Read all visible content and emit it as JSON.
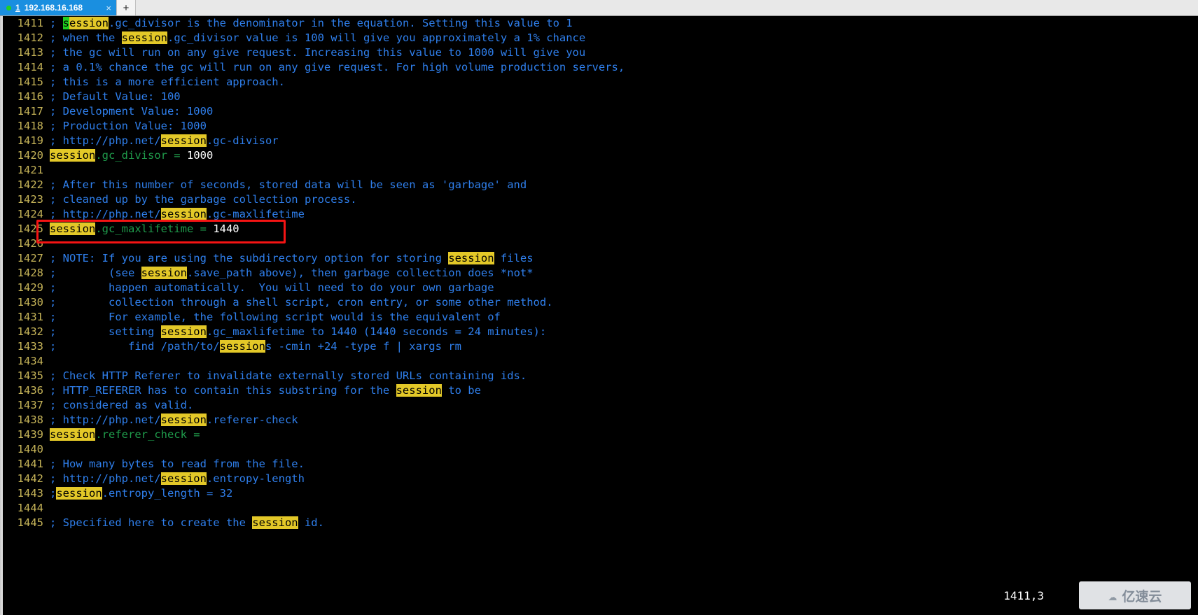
{
  "window": {
    "tab": {
      "index": "1",
      "title": "192.168.16.168",
      "close_label": "×",
      "status_dot": "connected",
      "new_tab_label": "+"
    },
    "accent_color": "#1a8fe0"
  },
  "editor": {
    "cursor_position": "1411,3",
    "highlight_term": "session",
    "colors": {
      "background": "#000000",
      "linenumber": "#c5b358",
      "comment": "#2f7fec",
      "directive": "#1f9b4b",
      "value": "#ffffff",
      "search_highlight_bg": "#e3c828",
      "cursor_bg": "#1fcf1f",
      "annotation": "#f41414"
    },
    "annotation": {
      "shape": "rectangle",
      "target_line": "1425",
      "target_text": "session.gc_maxlifetime = 1440"
    },
    "lines": [
      {
        "n": "1411",
        "segs": [
          {
            "t": "; ",
            "c": "cm"
          },
          {
            "t": "s",
            "c": "cur"
          },
          {
            "t": "ession",
            "c": "hl"
          },
          {
            "t": ".gc_divisor is the denominator in the equation. Setting this value to 1",
            "c": "cm"
          }
        ]
      },
      {
        "n": "1412",
        "segs": [
          {
            "t": "; when the ",
            "c": "cm"
          },
          {
            "t": "session",
            "c": "hl"
          },
          {
            "t": ".gc_divisor value is 100 will give you approximately a 1% chance",
            "c": "cm"
          }
        ]
      },
      {
        "n": "1413",
        "segs": [
          {
            "t": "; the gc will run on any give request. Increasing this value to 1000 will give you",
            "c": "cm"
          }
        ]
      },
      {
        "n": "1414",
        "segs": [
          {
            "t": "; a 0.1% chance the gc will run on any give request. For high volume production servers,",
            "c": "cm"
          }
        ]
      },
      {
        "n": "1415",
        "segs": [
          {
            "t": "; this is a more efficient approach.",
            "c": "cm"
          }
        ]
      },
      {
        "n": "1416",
        "segs": [
          {
            "t": "; Default Value: 100",
            "c": "cm"
          }
        ]
      },
      {
        "n": "1417",
        "segs": [
          {
            "t": "; Development Value: 1000",
            "c": "cm"
          }
        ]
      },
      {
        "n": "1418",
        "segs": [
          {
            "t": "; Production Value: 1000",
            "c": "cm"
          }
        ]
      },
      {
        "n": "1419",
        "segs": [
          {
            "t": "; http://php.net/",
            "c": "cm"
          },
          {
            "t": "session",
            "c": "hl"
          },
          {
            "t": ".gc-divisor",
            "c": "cm"
          }
        ]
      },
      {
        "n": "1420",
        "segs": [
          {
            "t": "session",
            "c": "hl"
          },
          {
            "t": ".gc_divisor = ",
            "c": "dr"
          },
          {
            "t": "1000",
            "c": "vl"
          }
        ]
      },
      {
        "n": "1421",
        "segs": []
      },
      {
        "n": "1422",
        "segs": [
          {
            "t": "; After this number of seconds, stored data will be seen as 'garbage' and",
            "c": "cm"
          }
        ]
      },
      {
        "n": "1423",
        "segs": [
          {
            "t": "; cleaned up by the garbage collection process.",
            "c": "cm"
          }
        ]
      },
      {
        "n": "1424",
        "segs": [
          {
            "t": "; http://php.net/",
            "c": "cm"
          },
          {
            "t": "session",
            "c": "hl"
          },
          {
            "t": ".gc-maxlifetime",
            "c": "cm"
          }
        ]
      },
      {
        "n": "1425",
        "segs": [
          {
            "t": "session",
            "c": "hl"
          },
          {
            "t": ".gc_maxlifetime = ",
            "c": "dr"
          },
          {
            "t": "1440",
            "c": "vl"
          }
        ]
      },
      {
        "n": "1426",
        "segs": []
      },
      {
        "n": "1427",
        "segs": [
          {
            "t": "; NOTE: If you are using the subdirectory option for storing ",
            "c": "cm"
          },
          {
            "t": "session",
            "c": "hl"
          },
          {
            "t": " files",
            "c": "cm"
          }
        ]
      },
      {
        "n": "1428",
        "segs": [
          {
            "t": ";        (see ",
            "c": "cm"
          },
          {
            "t": "session",
            "c": "hl"
          },
          {
            "t": ".save_path above), then garbage collection does *not*",
            "c": "cm"
          }
        ]
      },
      {
        "n": "1429",
        "segs": [
          {
            "t": ";        happen automatically.  You will need to do your own garbage",
            "c": "cm"
          }
        ]
      },
      {
        "n": "1430",
        "segs": [
          {
            "t": ";        collection through a shell script, cron entry, or some other method.",
            "c": "cm"
          }
        ]
      },
      {
        "n": "1431",
        "segs": [
          {
            "t": ";        For example, the following script would is the equivalent of",
            "c": "cm"
          }
        ]
      },
      {
        "n": "1432",
        "segs": [
          {
            "t": ";        setting ",
            "c": "cm"
          },
          {
            "t": "session",
            "c": "hl"
          },
          {
            "t": ".gc_maxlifetime to 1440 (1440 seconds = 24 minutes):",
            "c": "cm"
          }
        ]
      },
      {
        "n": "1433",
        "segs": [
          {
            "t": ";           find /path/to/",
            "c": "cm"
          },
          {
            "t": "session",
            "c": "hl"
          },
          {
            "t": "s -cmin +24 -type f | xargs rm",
            "c": "cm"
          }
        ]
      },
      {
        "n": "1434",
        "segs": []
      },
      {
        "n": "1435",
        "segs": [
          {
            "t": "; Check HTTP Referer to invalidate externally stored URLs containing ids.",
            "c": "cm"
          }
        ]
      },
      {
        "n": "1436",
        "segs": [
          {
            "t": "; HTTP_REFERER has to contain this substring for the ",
            "c": "cm"
          },
          {
            "t": "session",
            "c": "hl"
          },
          {
            "t": " to be",
            "c": "cm"
          }
        ]
      },
      {
        "n": "1437",
        "segs": [
          {
            "t": "; considered as valid.",
            "c": "cm"
          }
        ]
      },
      {
        "n": "1438",
        "segs": [
          {
            "t": "; http://php.net/",
            "c": "cm"
          },
          {
            "t": "session",
            "c": "hl"
          },
          {
            "t": ".referer-check",
            "c": "cm"
          }
        ]
      },
      {
        "n": "1439",
        "segs": [
          {
            "t": "session",
            "c": "hl"
          },
          {
            "t": ".referer_check =",
            "c": "dr"
          }
        ]
      },
      {
        "n": "1440",
        "segs": []
      },
      {
        "n": "1441",
        "segs": [
          {
            "t": "; How many bytes to read from the file.",
            "c": "cm"
          }
        ]
      },
      {
        "n": "1442",
        "segs": [
          {
            "t": "; http://php.net/",
            "c": "cm"
          },
          {
            "t": "session",
            "c": "hl"
          },
          {
            "t": ".entropy-length",
            "c": "cm"
          }
        ]
      },
      {
        "n": "1443",
        "segs": [
          {
            "t": ";",
            "c": "cm"
          },
          {
            "t": "session",
            "c": "hl"
          },
          {
            "t": ".entropy_length = 32",
            "c": "cm"
          }
        ]
      },
      {
        "n": "1444",
        "segs": []
      },
      {
        "n": "1445",
        "segs": [
          {
            "t": "; Specified here to create the ",
            "c": "cm"
          },
          {
            "t": "session",
            "c": "hl"
          },
          {
            "t": " id.",
            "c": "cm"
          }
        ]
      }
    ]
  },
  "watermark": {
    "icon": "cloud-icon",
    "text": "亿速云"
  }
}
